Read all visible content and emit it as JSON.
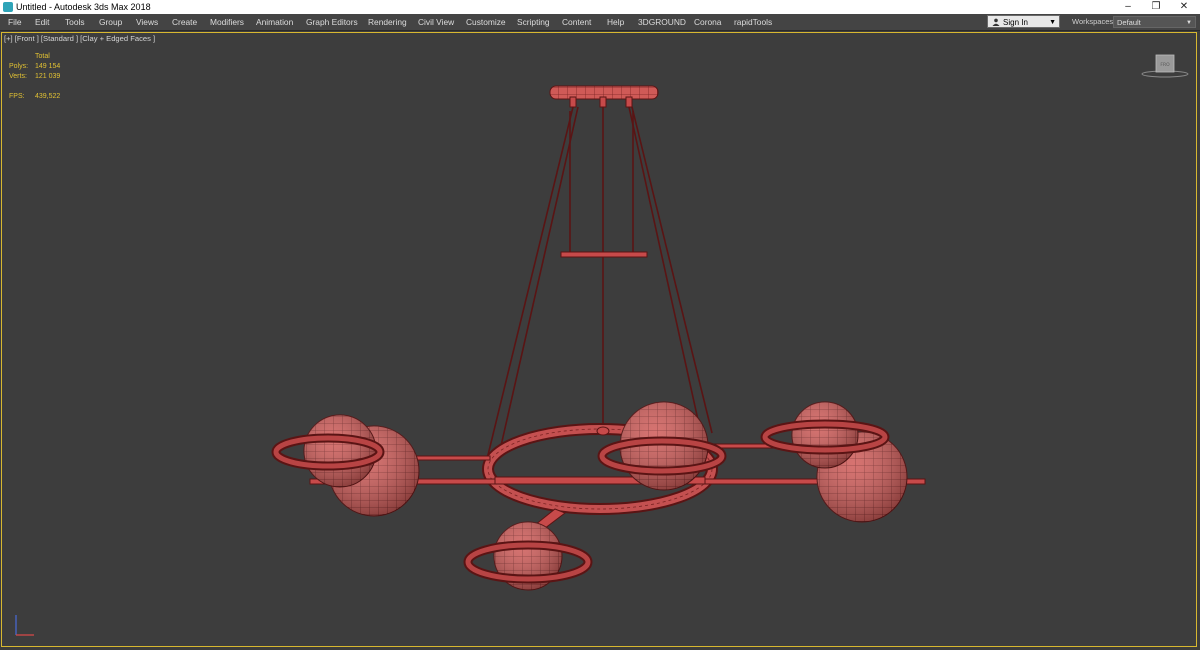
{
  "window": {
    "title": "Untitled - Autodesk 3ds Max 2018",
    "controls": {
      "minimize": "–",
      "restore": "❐",
      "close": "✕"
    }
  },
  "menu": {
    "items": [
      "File",
      "Edit",
      "Tools",
      "Group",
      "Views",
      "Create",
      "Modifiers",
      "Animation",
      "Graph Editors",
      "Rendering",
      "Civil View",
      "Customize",
      "Scripting",
      "Content",
      "Help",
      "3DGROUND",
      "Corona",
      "rapidTools"
    ],
    "sign_in": "Sign In",
    "workspaces_label": "Workspaces:",
    "workspace_value": "Default"
  },
  "viewport": {
    "label": "[+] [Front ] [Standard ] [Clay + Edged Faces ]",
    "stats": {
      "header": "Total",
      "polys_label": "Polys:",
      "polys_value": "149 154",
      "verts_label": "Verts:",
      "verts_value": "121 039",
      "fps_label": "FPS:",
      "fps_value": "439,522"
    },
    "viewcube_label": "FRO"
  },
  "colors": {
    "viewport_bg": "#3d3d3d",
    "model_fill": "#c74a4a",
    "wire": "#5a1414",
    "stats_text": "#e2c233",
    "active_border": "#d8b830"
  },
  "icons": {
    "app": "3ds-max-app-icon",
    "user": "person-icon",
    "dropdown": "chevron-down-icon",
    "axis": "axis-tripod-icon"
  }
}
